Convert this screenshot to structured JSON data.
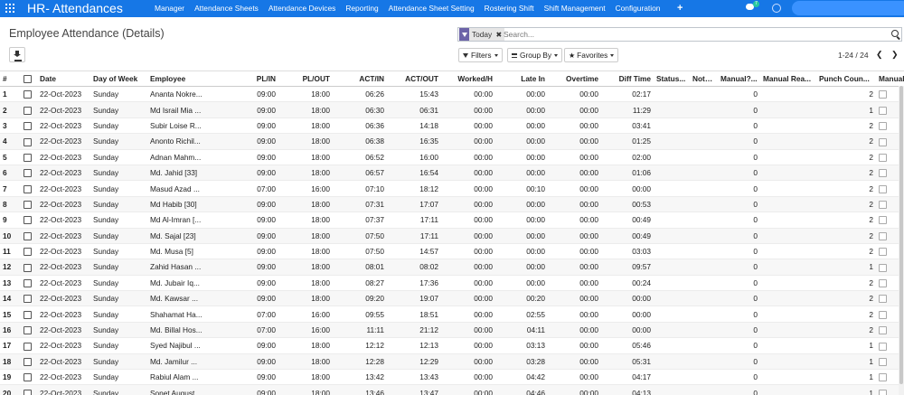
{
  "app": {
    "title": "HR- Attendances"
  },
  "nav": [
    "Manager",
    "Attendance Sheets",
    "Attendance Devices",
    "Reporting",
    "Attendance Sheet Setting",
    "Rostering Shift",
    "Shift Management",
    "Configuration"
  ],
  "systray": {
    "plus": "+",
    "chat_badge": "7"
  },
  "page": {
    "title": "Employee Attendance (Details)"
  },
  "search": {
    "facet": "Today",
    "placeholder": "Search..."
  },
  "toolbar": {
    "filters": "Filters",
    "group_by": "Group By",
    "favorites": "Favorites"
  },
  "pager": {
    "text": "1-24 / 24"
  },
  "columns": [
    "#",
    "",
    "Date",
    "Day of Week",
    "Employee",
    "PL/IN",
    "PL/OUT",
    "ACT/IN",
    "ACT/OUT",
    "Worked/H",
    "Late In",
    "Overtime",
    "Diff Time",
    "Status...",
    "Note...",
    "Manual?...",
    "Manual Rea...",
    "Punch Coun...",
    "Manual Abs..."
  ],
  "rows": [
    [
      "1",
      "22-Oct-2023",
      "Sunday",
      "Ananta Nokre...",
      "09:00",
      "18:00",
      "06:26",
      "15:43",
      "00:00",
      "00:00",
      "00:00",
      "02:17",
      "0",
      "2"
    ],
    [
      "2",
      "22-Oct-2023",
      "Sunday",
      "Md Israil Mia ...",
      "09:00",
      "18:00",
      "06:30",
      "06:31",
      "00:00",
      "00:00",
      "00:00",
      "11:29",
      "0",
      "1"
    ],
    [
      "3",
      "22-Oct-2023",
      "Sunday",
      "Subir Loise R...",
      "09:00",
      "18:00",
      "06:36",
      "14:18",
      "00:00",
      "00:00",
      "00:00",
      "03:41",
      "0",
      "2"
    ],
    [
      "4",
      "22-Oct-2023",
      "Sunday",
      "Anonto Richil...",
      "09:00",
      "18:00",
      "06:38",
      "16:35",
      "00:00",
      "00:00",
      "00:00",
      "01:25",
      "0",
      "2"
    ],
    [
      "5",
      "22-Oct-2023",
      "Sunday",
      "Adnan Mahm...",
      "09:00",
      "18:00",
      "06:52",
      "16:00",
      "00:00",
      "00:00",
      "00:00",
      "02:00",
      "0",
      "2"
    ],
    [
      "6",
      "22-Oct-2023",
      "Sunday",
      "Md. Jahid [33]",
      "09:00",
      "18:00",
      "06:57",
      "16:54",
      "00:00",
      "00:00",
      "00:00",
      "01:06",
      "0",
      "2"
    ],
    [
      "7",
      "22-Oct-2023",
      "Sunday",
      "Masud Azad ...",
      "07:00",
      "16:00",
      "07:10",
      "18:12",
      "00:00",
      "00:10",
      "00:00",
      "00:00",
      "0",
      "2"
    ],
    [
      "8",
      "22-Oct-2023",
      "Sunday",
      "Md Habib [30]",
      "09:00",
      "18:00",
      "07:31",
      "17:07",
      "00:00",
      "00:00",
      "00:00",
      "00:53",
      "0",
      "2"
    ],
    [
      "9",
      "22-Oct-2023",
      "Sunday",
      "Md Al-Imran [...",
      "09:00",
      "18:00",
      "07:37",
      "17:11",
      "00:00",
      "00:00",
      "00:00",
      "00:49",
      "0",
      "2"
    ],
    [
      "10",
      "22-Oct-2023",
      "Sunday",
      "Md. Sajal [23]",
      "09:00",
      "18:00",
      "07:50",
      "17:11",
      "00:00",
      "00:00",
      "00:00",
      "00:49",
      "0",
      "2"
    ],
    [
      "11",
      "22-Oct-2023",
      "Sunday",
      "Md. Musa [5]",
      "09:00",
      "18:00",
      "07:50",
      "14:57",
      "00:00",
      "00:00",
      "00:00",
      "03:03",
      "0",
      "2"
    ],
    [
      "12",
      "22-Oct-2023",
      "Sunday",
      "Zahid Hasan ...",
      "09:00",
      "18:00",
      "08:01",
      "08:02",
      "00:00",
      "00:00",
      "00:00",
      "09:57",
      "0",
      "1"
    ],
    [
      "13",
      "22-Oct-2023",
      "Sunday",
      "Md. Jubair Iq...",
      "09:00",
      "18:00",
      "08:27",
      "17:36",
      "00:00",
      "00:00",
      "00:00",
      "00:24",
      "0",
      "2"
    ],
    [
      "14",
      "22-Oct-2023",
      "Sunday",
      "Md. Kawsar ...",
      "09:00",
      "18:00",
      "09:20",
      "19:07",
      "00:00",
      "00:20",
      "00:00",
      "00:00",
      "0",
      "2"
    ],
    [
      "15",
      "22-Oct-2023",
      "Sunday",
      "Shahamat Ha...",
      "07:00",
      "16:00",
      "09:55",
      "18:51",
      "00:00",
      "02:55",
      "00:00",
      "00:00",
      "0",
      "2"
    ],
    [
      "16",
      "22-Oct-2023",
      "Sunday",
      "Md. Billal Hos...",
      "07:00",
      "16:00",
      "11:11",
      "21:12",
      "00:00",
      "04:11",
      "00:00",
      "00:00",
      "0",
      "2"
    ],
    [
      "17",
      "22-Oct-2023",
      "Sunday",
      "Syed Najibul ...",
      "09:00",
      "18:00",
      "12:12",
      "12:13",
      "00:00",
      "03:13",
      "00:00",
      "05:46",
      "0",
      "1"
    ],
    [
      "18",
      "22-Oct-2023",
      "Sunday",
      "Md. Jamilur ...",
      "09:00",
      "18:00",
      "12:28",
      "12:29",
      "00:00",
      "03:28",
      "00:00",
      "05:31",
      "0",
      "1"
    ],
    [
      "19",
      "22-Oct-2023",
      "Sunday",
      "Rabiul Alam ...",
      "09:00",
      "18:00",
      "13:42",
      "13:43",
      "00:00",
      "04:42",
      "00:00",
      "04:17",
      "0",
      "1"
    ],
    [
      "20",
      "22-Oct-2023",
      "Sunday",
      "Sonet August...",
      "09:00",
      "18:00",
      "13:46",
      "13:47",
      "00:00",
      "04:46",
      "00:00",
      "04:13",
      "0",
      "1"
    ]
  ],
  "colors": {
    "navbar": "#1677e6",
    "facet_icon": "#6c63a8",
    "row_stripe": "#f7f7f7"
  }
}
